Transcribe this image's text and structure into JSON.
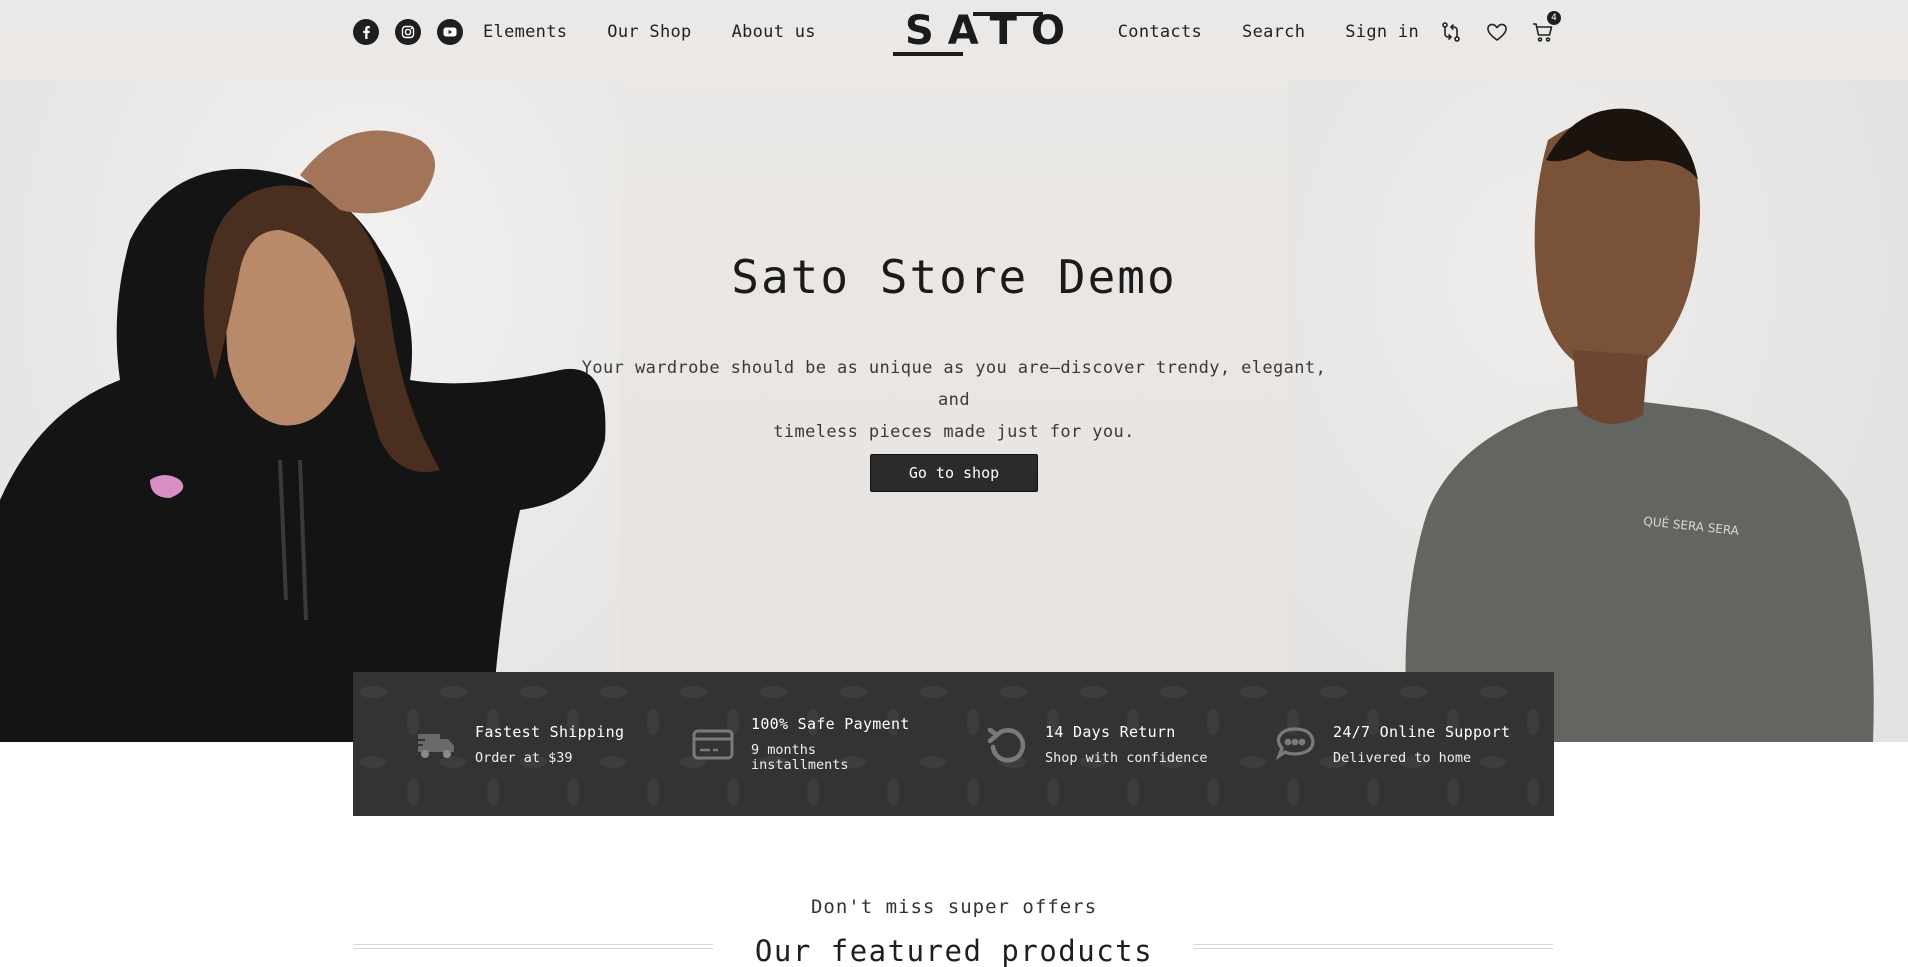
{
  "header": {
    "social": [
      {
        "icon": "facebook-icon"
      },
      {
        "icon": "instagram-icon"
      },
      {
        "icon": "youtube-icon"
      }
    ],
    "nav_left": [
      "Elements",
      "Our Shop",
      "About us"
    ],
    "logo_text": "SATO",
    "nav_right": [
      "Contacts",
      "Search",
      "Sign in"
    ],
    "icons": [
      "compare-icon",
      "heart-icon",
      "cart-icon"
    ],
    "cart_count": "4"
  },
  "hero": {
    "title": "Sato Store Demo",
    "subtitle_line1": "Your wardrobe should be as unique as you are—discover trendy, elegant, and",
    "subtitle_line2": "timeless pieces made just for you.",
    "button": "Go to shop"
  },
  "features": [
    {
      "icon": "truck-icon",
      "title": "Fastest Shipping",
      "subtitle": "Order at $39"
    },
    {
      "icon": "credit-card-icon",
      "title": "100% Safe Payment",
      "subtitle_line1": "9 months",
      "subtitle_line2": "installments"
    },
    {
      "icon": "return-icon",
      "title": "14 Days Return",
      "subtitle": "Shop with confidence"
    },
    {
      "icon": "chat-icon",
      "title": "24/7 Online Support",
      "subtitle": "Delivered to home"
    }
  ],
  "section": {
    "kicker": "Don't miss super offers",
    "title": "Our featured products"
  },
  "colors": {
    "dark": "#2b2b2b",
    "hero_bg": "#eae7e4",
    "feature_bar": "#333333"
  }
}
